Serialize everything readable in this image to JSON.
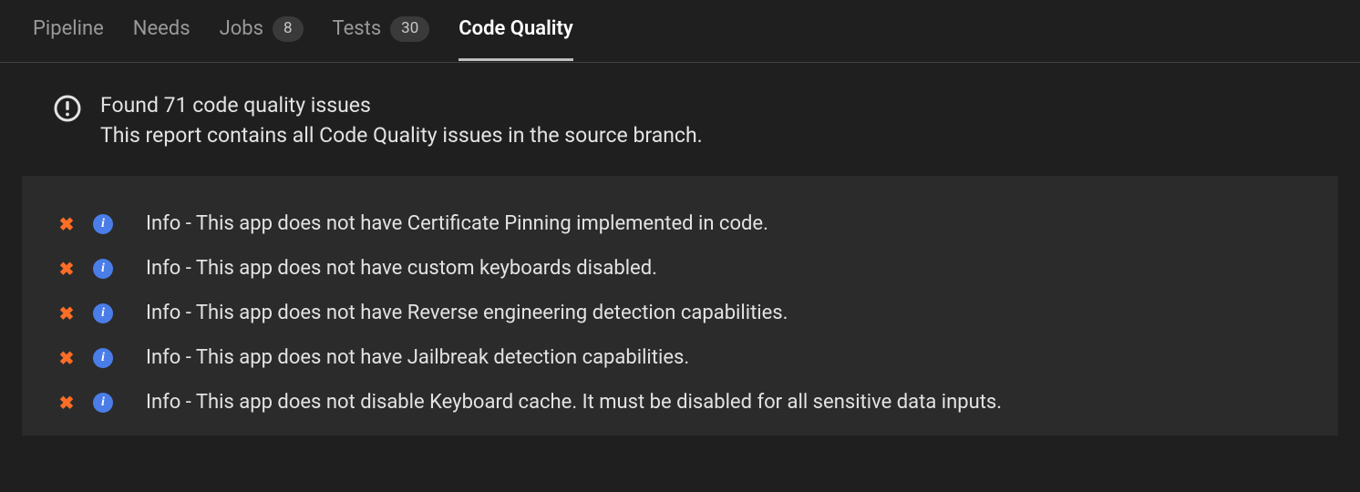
{
  "tabs": [
    {
      "label": "Pipeline",
      "count": null,
      "active": false
    },
    {
      "label": "Needs",
      "count": null,
      "active": false
    },
    {
      "label": "Jobs",
      "count": "8",
      "active": false
    },
    {
      "label": "Tests",
      "count": "30",
      "active": false
    },
    {
      "label": "Code Quality",
      "count": null,
      "active": true
    }
  ],
  "summary": {
    "title": "Found 71 code quality issues",
    "subtitle": "This report contains all Code Quality issues in the source branch."
  },
  "issues": [
    {
      "severity": "Info",
      "text": "Info - This app does not have Certificate Pinning implemented in code."
    },
    {
      "severity": "Info",
      "text": "Info - This app does not have custom keyboards disabled."
    },
    {
      "severity": "Info",
      "text": "Info - This app does not have Reverse engineering detection capabilities."
    },
    {
      "severity": "Info",
      "text": "Info - This app does not have Jailbreak detection capabilities."
    },
    {
      "severity": "Info",
      "text": "Info - This app does not disable Keyboard cache. It must be disabled for all sensitive data inputs."
    }
  ]
}
